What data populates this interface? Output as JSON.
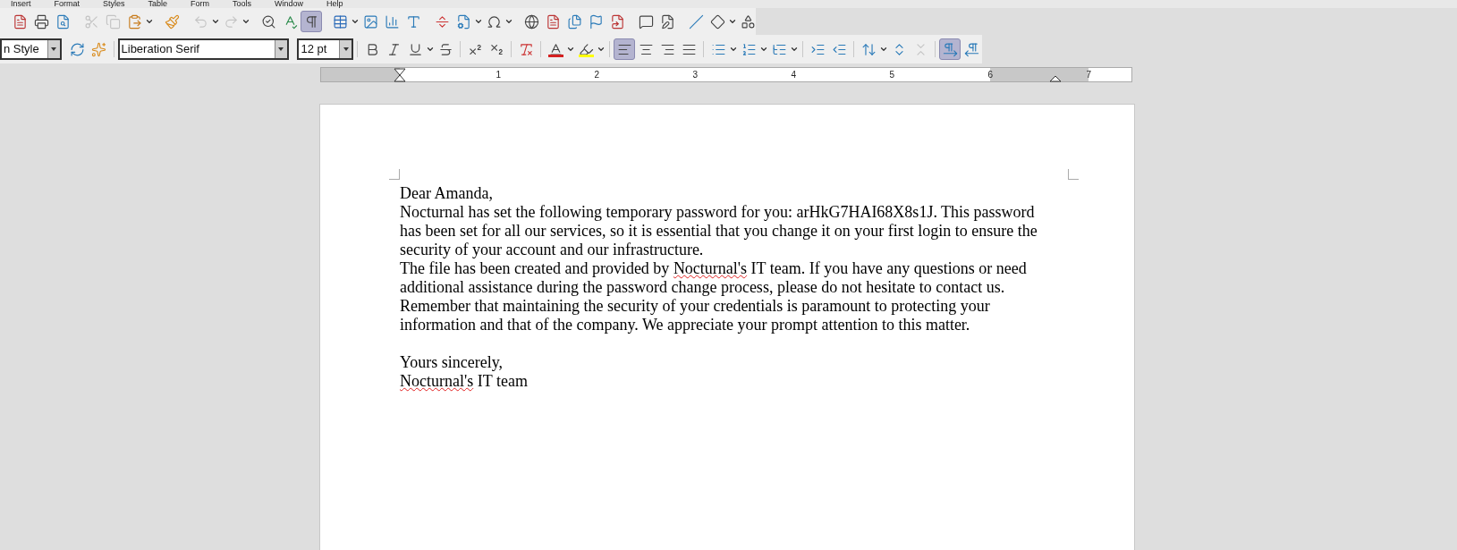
{
  "menu_bar": [
    "Insert",
    "Format",
    "Styles",
    "Table",
    "Form",
    "Tools",
    "Window",
    "Help"
  ],
  "toolbar": {
    "edit_buttons": [
      {
        "disabled": true
      },
      {
        "disabled": true
      },
      {
        "disabled": false
      }
    ],
    "history_buttons": [
      {
        "disabled": true
      },
      {
        "disabled": true
      }
    ],
    "formatting_marks_on": true
  },
  "formatting_bar": {
    "paragraph_style": "n Style",
    "font_name": "Liberation Serif",
    "font_size": "12 pt",
    "align_buttons": [
      {
        "selected": true
      },
      {
        "selected": false
      },
      {
        "selected": false
      },
      {
        "selected": false
      }
    ],
    "direction_buttons": [
      {
        "selected": true
      },
      {
        "selected": false
      }
    ]
  },
  "ruler": [
    "1",
    "2",
    "3",
    "4",
    "5",
    "6",
    "7"
  ],
  "document": {
    "paragraphs": [
      {
        "gap_before": false,
        "runs": [
          {
            "text": "Dear Amanda,",
            "misspelled": false
          }
        ]
      },
      {
        "gap_before": false,
        "runs": [
          {
            "text": "Nocturnal has set the following temporary password for you: arHkG7HAI68X8s1J. This password has been set for all our services, so it is essential that you change it on your first login to ensure the security of your account and our infrastructure.",
            "misspelled": false
          }
        ]
      },
      {
        "gap_before": false,
        "runs": [
          {
            "text": "The file has been created and provided by ",
            "misspelled": false
          },
          {
            "text": "Nocturnal's",
            "misspelled": true
          },
          {
            "text": " IT team. If you have any questions or need additional assistance during the password change process, please do not hesitate to contact us. Remember that maintaining the security of your credentials is paramount to protecting your information and that of the company. We appreciate your prompt attention to this matter.",
            "misspelled": false
          }
        ]
      },
      {
        "gap_before": true,
        "runs": [
          {
            "text": "Yours sincerely,",
            "misspelled": false
          }
        ]
      },
      {
        "gap_before": false,
        "runs": [
          {
            "text": "Nocturnal's",
            "misspelled": true
          },
          {
            "text": " IT team",
            "misspelled": false
          }
        ]
      }
    ]
  }
}
